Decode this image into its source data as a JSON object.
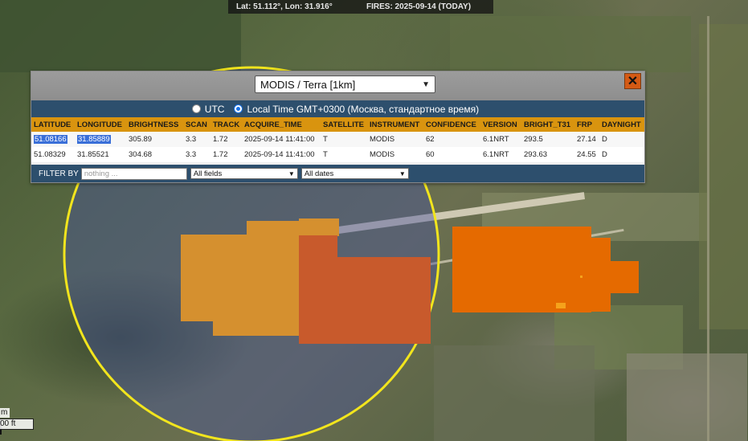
{
  "topbar": {
    "coords": "Lat: 51.112°, Lon: 31.916°",
    "fires": "FIRES: 2025-09-14 (TODAY)"
  },
  "panel": {
    "sensor": "MODIS / Terra [1km]",
    "close_label": "✕",
    "tz_utc": "UTC",
    "tz_local": "Local Time GMT+0300 (Москва, стандартное время)",
    "columns": [
      "LATITUDE",
      "LONGITUDE",
      "BRIGHTNESS",
      "SCAN",
      "TRACK",
      "ACQUIRE_TIME",
      "SATELLITE",
      "INSTRUMENT",
      "CONFIDENCE",
      "VERSION",
      "BRIGHT_T31",
      "FRP",
      "DAYNIGHT"
    ],
    "rows": [
      [
        "51.08166",
        "31.85889",
        "305.89",
        "3.3",
        "1.72",
        "2025-09-14 11:41:00",
        "T",
        "MODIS",
        "62",
        "6.1NRT",
        "293.5",
        "27.14",
        "D"
      ],
      [
        "51.08329",
        "31.85521",
        "304.68",
        "3.3",
        "1.72",
        "2025-09-14 11:41:00",
        "T",
        "MODIS",
        "60",
        "6.1NRT",
        "293.63",
        "24.55",
        "D"
      ]
    ],
    "filter_label": "FILTER BY",
    "filter_placeholder": "nothing ...",
    "field_select": "All fields",
    "date_select": "All dates"
  },
  "scale": {
    "metric": "m",
    "imperial": "00 ft"
  },
  "colors": {
    "fire_light": "#d5902f",
    "fire_dark": "#c85a2c",
    "fire_bright": "#e56a00",
    "circle": "#f2e51d",
    "header_bar": "#2d4f6d",
    "table_header": "#d9940f"
  }
}
